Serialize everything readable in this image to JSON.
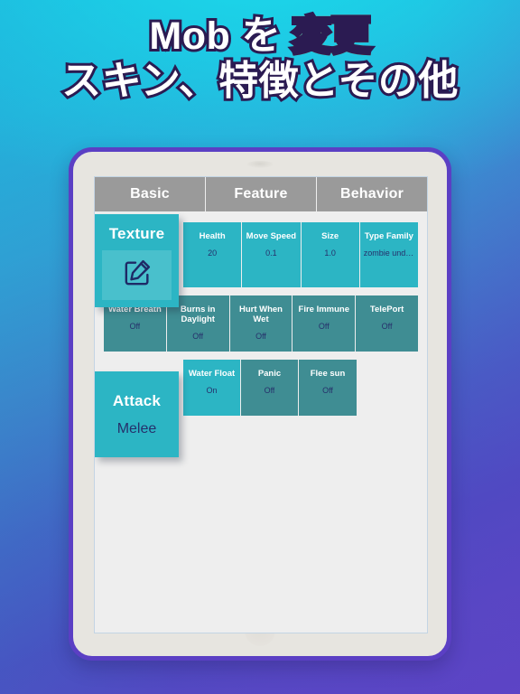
{
  "headline": {
    "line1_white": "Mob を ",
    "line1_gold": "変更",
    "line2": "スキン、特徴とその他",
    "white_color": "#ffffff",
    "gold_color": "#ffa310",
    "outline_color": "#2b1b52"
  },
  "device": {
    "frame_color": "#5b3fc4",
    "bezel_color": "#e7e5e0"
  },
  "app": {
    "tabs": [
      {
        "label": "Basic",
        "selected": true
      },
      {
        "label": "Feature",
        "selected": false
      },
      {
        "label": "Behavior",
        "selected": false
      }
    ],
    "tabbar_color": "#9a9a9a",
    "accent_light": "#2cb5c4",
    "accent_dark": "#3f8d93",
    "value_text_color": "#26306b",
    "texture_card": {
      "title": "Texture",
      "icon": "edit-pencil-square-icon"
    },
    "attack_card": {
      "title": "Attack",
      "value": "Melee"
    },
    "row1": [
      {
        "title": "Health",
        "value": "20",
        "tone": "light"
      },
      {
        "title": "Move Speed",
        "value": "0.1",
        "tone": "light"
      },
      {
        "title": "Size",
        "value": "1.0",
        "tone": "light"
      },
      {
        "title": "Type Family",
        "value": "zombie undea...",
        "tone": "light"
      }
    ],
    "row2": [
      {
        "title": "Water Breath",
        "value": "Off",
        "tone": "dark"
      },
      {
        "title": "Burns in Daylight",
        "value": "Off",
        "tone": "dark"
      },
      {
        "title": "Hurt When Wet",
        "value": "Off",
        "tone": "dark"
      },
      {
        "title": "Fire Immune",
        "value": "Off",
        "tone": "dark"
      },
      {
        "title": "TelePort",
        "value": "Off",
        "tone": "dark"
      }
    ],
    "row3": [
      {
        "title": "Water Float",
        "value": "On",
        "tone": "light"
      },
      {
        "title": "Panic",
        "value": "Off",
        "tone": "dark"
      },
      {
        "title": "Flee sun",
        "value": "Off",
        "tone": "dark"
      }
    ]
  }
}
